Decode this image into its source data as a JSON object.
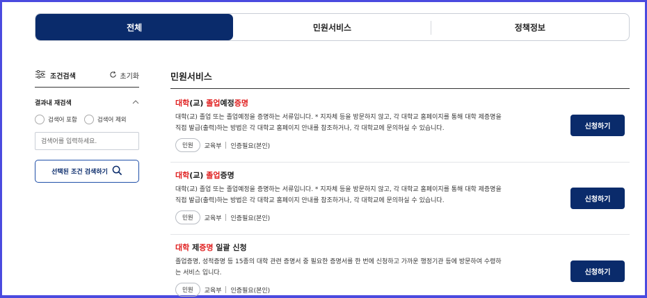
{
  "tabs": [
    {
      "label": "전체",
      "active": true
    },
    {
      "label": "민원서비스",
      "active": false
    },
    {
      "label": "정책정보",
      "active": false
    }
  ],
  "sidebar": {
    "title": "조건검색",
    "reset_label": "초기화",
    "inner_search_label": "결과내 재검색",
    "radio_include": "검색어 포함",
    "radio_exclude": "검색어 제외",
    "input_placeholder": "검색어를 입력하세요.",
    "search_button": "선택된 조건 검색하기"
  },
  "main": {
    "title": "민원서비스",
    "items": [
      {
        "title_parts": [
          {
            "text": "대학",
            "hl": true
          },
          {
            "text": "(교) ",
            "hl": false
          },
          {
            "text": "졸업",
            "hl": true
          },
          {
            "text": "예정",
            "hl": false
          },
          {
            "text": "증명",
            "hl": true
          }
        ],
        "desc_line1": "대학(교) 졸업 또는 졸업예정을 증명하는 서류입니다. * 지자체 등을 방문하지 않고, 각 대학교 홈페이지를 통해 대학 제증명을",
        "desc_line2": "직접 발급(출력)하는 방법은 각 대학교 홈페이지 안내를 참조하거나, 각 대학교에 문의하실 수 있습니다.",
        "tag": "민원",
        "dept": "교육부",
        "auth": "인증필요(본인)",
        "button": "신청하기"
      },
      {
        "title_parts": [
          {
            "text": "대학",
            "hl": true
          },
          {
            "text": "(교) ",
            "hl": false
          },
          {
            "text": "졸업",
            "hl": true
          },
          {
            "text": "증명",
            "hl": false
          }
        ],
        "desc_line1": "대학(교) 졸업 또는 졸업예정을 증명하는 서류입니다. * 지자체 등을 방문하지 않고, 각 대학교 홈페이지를 통해 대학 제증명을",
        "desc_line2": "직접 발급(출력)하는 방법은 각 대학교 홈페이지 안내를 참조하거나, 각 대학교에 문의하실 수 있습니다.",
        "tag": "민원",
        "dept": "교육부",
        "auth": "인증필요(본인)",
        "button": "신청하기"
      },
      {
        "title_parts": [
          {
            "text": "대학",
            "hl": true
          },
          {
            "text": " 제",
            "hl": false
          },
          {
            "text": "증명",
            "hl": true
          },
          {
            "text": " 일괄 신청",
            "hl": false
          }
        ],
        "desc_line1": "졸업증명, 성적증명 등 15종의 대학 관련 증명서 중 필요한 증명서를 한 번에 신청하고 가까운 행정기관 등에 방문하여 수령하",
        "desc_line2": "는 서비스 입니다.",
        "tag": "민원",
        "dept": "교육부",
        "auth": "인증필요(본인)",
        "button": "신청하기"
      }
    ]
  },
  "colors": {
    "primary": "#0a2b6b",
    "highlight": "#e02020",
    "frame": "#4a4adf"
  }
}
